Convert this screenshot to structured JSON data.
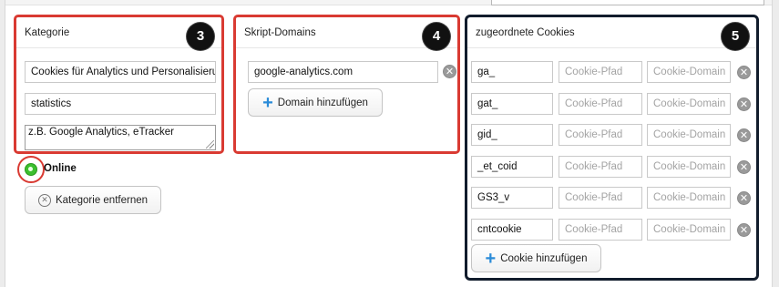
{
  "category": {
    "header": "Kategorie",
    "badge": "3",
    "name_value": "Cookies für Analytics und Personalisierung",
    "key_value": "statistics",
    "description_value": "z.B. Google Analytics, eTracker",
    "status_label": "Online",
    "remove_button": "Kategorie entfernen"
  },
  "domains": {
    "header": "Skript-Domains",
    "badge": "4",
    "items": [
      "google-analytics.com"
    ],
    "add_button": "Domain hinzufügen"
  },
  "cookies": {
    "header": "zugeordnete Cookies",
    "badge": "5",
    "path_placeholder": "Cookie-Pfad",
    "domain_placeholder": "Cookie-Domain",
    "rows": [
      {
        "name": "ga_"
      },
      {
        "name": "gat_"
      },
      {
        "name": "gid_"
      },
      {
        "name": "_et_coid"
      },
      {
        "name": "GS3_v"
      },
      {
        "name": "cntcookie"
      }
    ],
    "add_button": "Cookie hinzufügen"
  },
  "colors": {
    "highlight_red": "#d93a32",
    "highlight_dark": "#111c2c",
    "online_green": "#3cbf2f",
    "add_blue": "#2a8bd8"
  }
}
